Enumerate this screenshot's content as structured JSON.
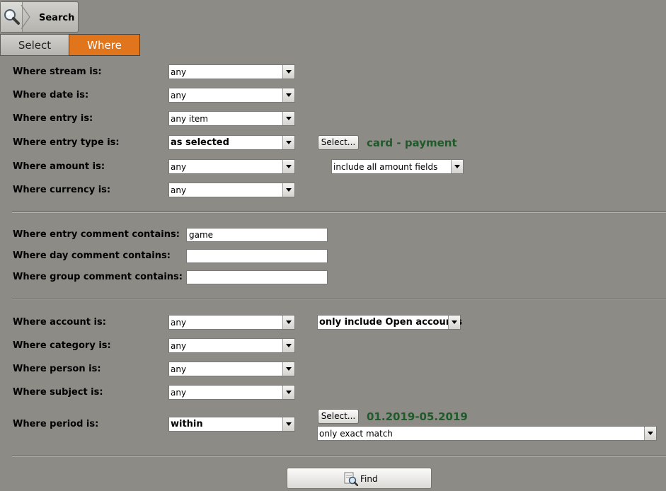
{
  "breadcrumb": {
    "title": "Search"
  },
  "tabs": {
    "select": "Select",
    "where": "Where"
  },
  "filters": {
    "stream": {
      "label": "Where stream is:",
      "value": "any"
    },
    "date": {
      "label": "Where date is:",
      "value": "any"
    },
    "entry": {
      "label": "Where entry is:",
      "value": "any item"
    },
    "entry_type": {
      "label": "Where entry type is:",
      "value": "as selected",
      "button": "Select...",
      "selection": "card - payment"
    },
    "amount": {
      "label": "Where amount is:",
      "value": "any",
      "fields_value": "include all amount fields"
    },
    "currency": {
      "label": "Where currency is:",
      "value": "any"
    }
  },
  "comments": {
    "entry": {
      "label": "Where entry comment contains:",
      "value": "game"
    },
    "day": {
      "label": "Where day comment contains:",
      "value": ""
    },
    "group": {
      "label": "Where group comment contains:",
      "value": ""
    }
  },
  "filters2": {
    "account": {
      "label": "Where account is:",
      "value": "any",
      "accounts_value": "only include Open accounts"
    },
    "category": {
      "label": "Where category is:",
      "value": "any"
    },
    "person": {
      "label": "Where person is:",
      "value": "any"
    },
    "subject": {
      "label": "Where subject is:",
      "value": "any"
    },
    "period": {
      "label": "Where period is:",
      "value": "within",
      "button": "Select...",
      "selection": "01.2019-05.2019",
      "match_value": "only exact match"
    }
  },
  "find_label": "Find",
  "colors": {
    "background": "#8c8b85",
    "tab_active": "#e0751c",
    "selection_text": "#1f5b2a"
  },
  "icons": {
    "breadcrumb": "magnifier-icon",
    "find": "find-icon",
    "dropdown": "chevron-down-icon"
  }
}
